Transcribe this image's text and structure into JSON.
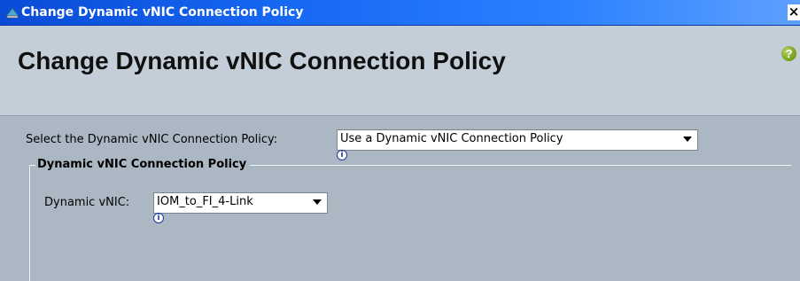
{
  "window": {
    "title": "Change Dynamic vNIC Connection Policy",
    "close_glyph": "×"
  },
  "header": {
    "title": "Change Dynamic vNIC Connection Policy",
    "help_glyph": "?"
  },
  "form": {
    "policy_select": {
      "label": "Select the Dynamic vNIC Connection Policy:",
      "value": "Use a Dynamic vNIC Connection Policy"
    },
    "group": {
      "legend": "Dynamic vNIC Connection Policy",
      "dynamic_vnic": {
        "label": "Dynamic vNIC:",
        "value": "IOM_to_FI_4-Link"
      }
    }
  },
  "colors": {
    "titlebar": "#1667f2",
    "header_bg": "#c3ced8",
    "body_bg": "#abb8c3",
    "help_green": "#7aa520"
  },
  "icons": {
    "window_icon": "app-icon",
    "help": "help-icon",
    "info": "info-icon",
    "dropdown": "chevron-down-icon"
  }
}
